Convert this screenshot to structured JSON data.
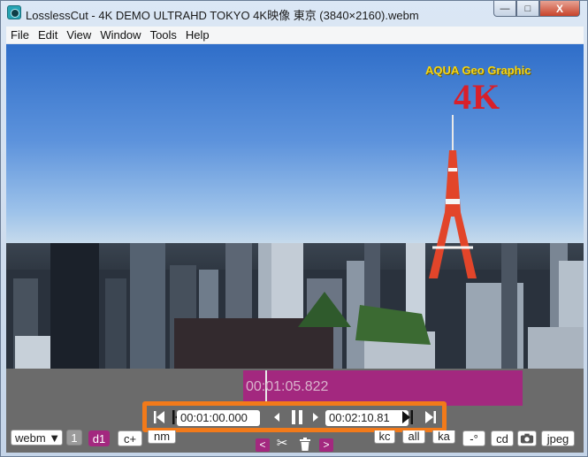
{
  "window": {
    "title": "LosslessCut - 4K DEMO ULTRAHD TOKYO 4K映像 東京 (3840×2160).webm",
    "min_icon": "minimize-icon",
    "max_icon": "maximize-icon",
    "close_icon": "close-icon",
    "min_glyph": "—",
    "max_glyph": "□",
    "close_glyph": "X"
  },
  "menu": [
    "File",
    "Edit",
    "View",
    "Window",
    "Tools",
    "Help"
  ],
  "video": {
    "watermark_title": "AQUA Geo Graphic",
    "watermark_4k": "4K"
  },
  "timeline": {
    "current_time": "00:01:05.822"
  },
  "controls": {
    "cut_start": "00:01:00.000",
    "cut_end": "00:02:10.81",
    "format": "webm ▼",
    "segment_count": "1",
    "segment_label": "d1",
    "buttons": [
      "c+",
      "nm",
      "kc",
      "all",
      "ka",
      "-°",
      "cd",
      "jpeg"
    ],
    "prev_glyph": "<",
    "next_glyph": ">",
    "scissors_glyph": "✂",
    "trash_glyph": "🗑",
    "camera_glyph": "📷"
  },
  "colors": {
    "accent": "#a3287f",
    "highlight": "#f27a1a",
    "panel": "#6b6b6b"
  }
}
